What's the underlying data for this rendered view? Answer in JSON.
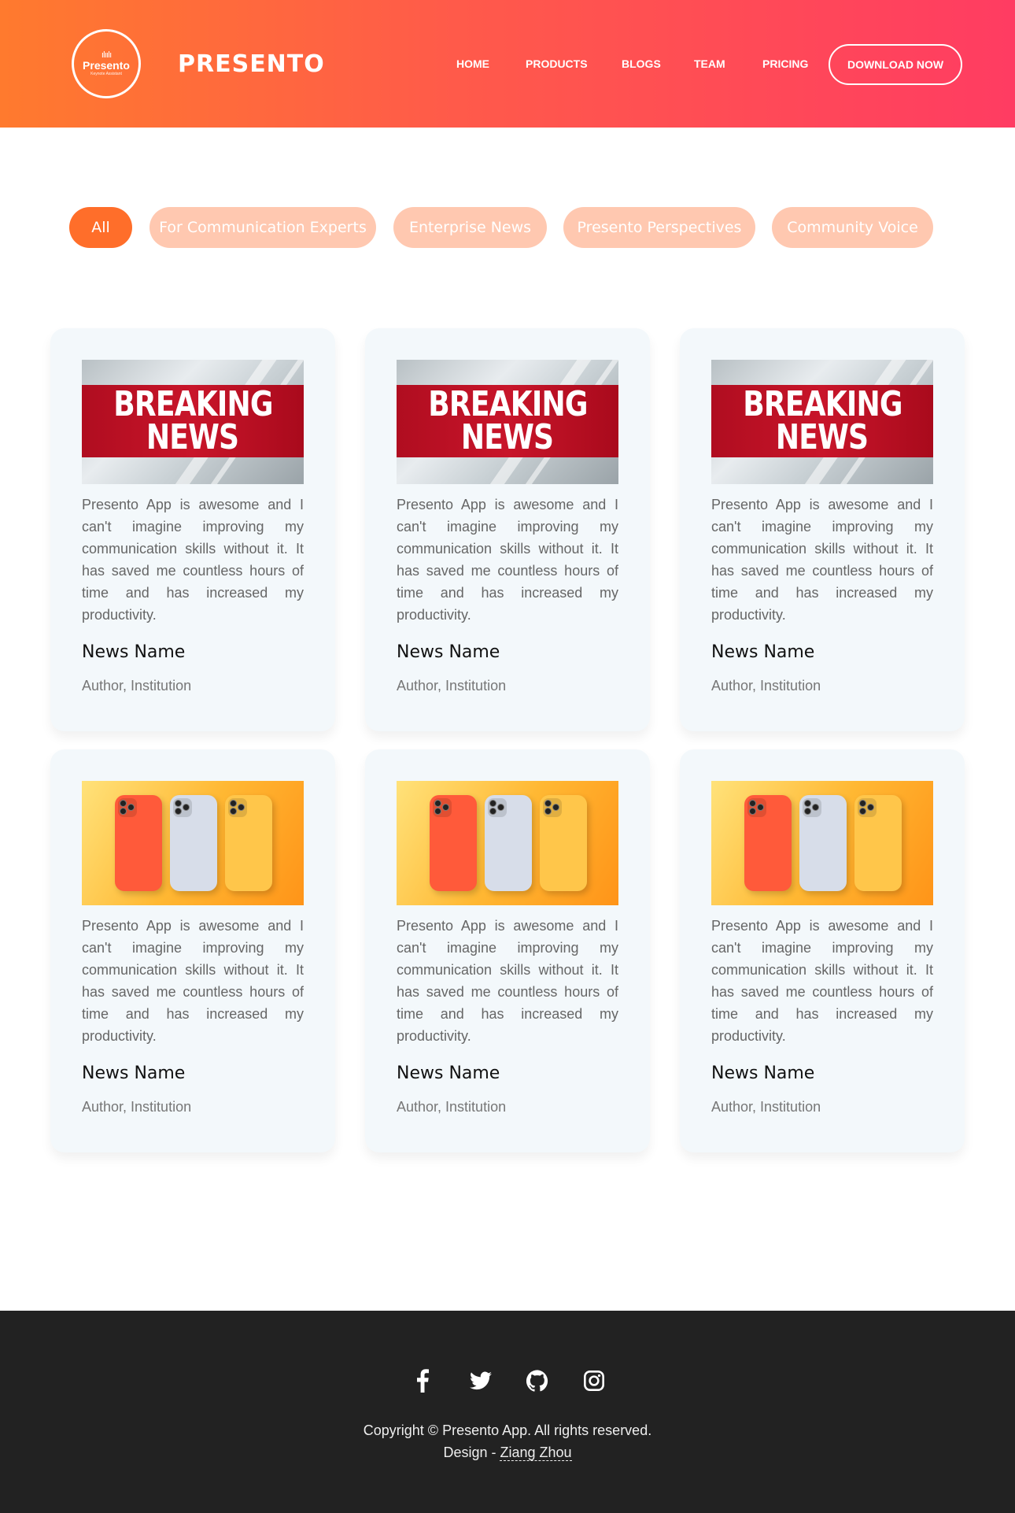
{
  "header": {
    "logo": {
      "text": "Presento",
      "subtext": "Keynote Assistant"
    },
    "brand": "PRESENTO",
    "nav": [
      {
        "label": "HOME"
      },
      {
        "label": "PRODUCTS"
      },
      {
        "label": "BLOGS"
      },
      {
        "label": "TEAM"
      },
      {
        "label": "PRICING"
      }
    ],
    "download_label": "DOWNLOAD NOW"
  },
  "filters": [
    {
      "label": "All",
      "active": true
    },
    {
      "label": "For Communication Experts",
      "active": false
    },
    {
      "label": "Enterprise News",
      "active": false
    },
    {
      "label": "Presento Perspectives",
      "active": false
    },
    {
      "label": "Community Voice",
      "active": false
    }
  ],
  "cards": [
    {
      "image": "breaking-news",
      "image_text": [
        "BREAKING",
        "NEWS"
      ],
      "text": "Presento App is awesome and I can't imagine improving my communication skills without it. It has saved me countless hours of time and has increased my productivity.",
      "title": "News Name",
      "author": "Author, Institution"
    },
    {
      "image": "breaking-news",
      "image_text": [
        "BREAKING",
        "NEWS"
      ],
      "text": "Presento App is awesome and I can't imagine improving my communication skills without it. It has saved me countless hours of time and has increased my productivity.",
      "title": "News Name",
      "author": "Author, Institution"
    },
    {
      "image": "breaking-news",
      "image_text": [
        "BREAKING",
        "NEWS"
      ],
      "text": "Presento App is awesome and I can't imagine improving my communication skills without it. It has saved me countless hours of time and has increased my productivity.",
      "title": "News Name",
      "author": "Author, Institution"
    },
    {
      "image": "phones",
      "text": "Presento App is awesome and I can't imagine improving my communication skills without it. It has saved me countless hours of time and has increased my productivity.",
      "title": "News Name",
      "author": "Author, Institution"
    },
    {
      "image": "phones",
      "text": "Presento App is awesome and I can't imagine improving my communication skills without it. It has saved me countless hours of time and has increased my productivity.",
      "title": "News Name",
      "author": "Author, Institution"
    },
    {
      "image": "phones",
      "text": "Presento App is awesome and I can't imagine improving my communication skills without it. It has saved me countless hours of time and has increased my productivity.",
      "title": "News Name",
      "author": "Author, Institution"
    }
  ],
  "footer": {
    "social": [
      "facebook-icon",
      "twitter-icon",
      "github-icon",
      "instagram-icon"
    ],
    "copyright": "Copyright © Presento App. All rights reserved.",
    "design_prefix": "Design - ",
    "design_author": "Ziang Zhou"
  },
  "colors": {
    "header_gradient_start": "#ff7a2e",
    "header_gradient_end": "#ff3c62",
    "filter_active": "#ff6e2a",
    "filter_inactive": "#ffc8b0",
    "card_bg": "#f3f8fb",
    "footer_bg": "#222222"
  }
}
